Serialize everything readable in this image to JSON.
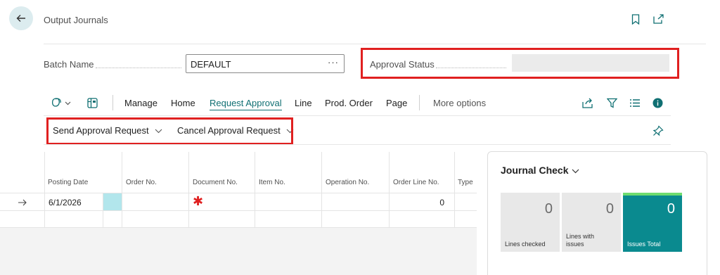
{
  "page": {
    "title": "Output Journals",
    "batch_label": "Batch Name",
    "batch_value": "DEFAULT",
    "batch_ellipsis": "···",
    "approval_status_label": "Approval Status",
    "approval_status_value": ""
  },
  "toolbar": {
    "items": [
      "Manage",
      "Home",
      "Request Approval",
      "Line",
      "Prod. Order",
      "Page"
    ],
    "active": "Request Approval",
    "more_options": "More options"
  },
  "subactions": {
    "send": "Send Approval Request",
    "cancel": "Cancel Approval Request"
  },
  "grid": {
    "columns": [
      "Posting Date",
      "Order No.",
      "Document No.",
      "Item No.",
      "Operation No.",
      "Order Line No.",
      "Type"
    ],
    "row1": {
      "posting_date": "6/1/2026",
      "order_no": "",
      "document_no_required": "✱",
      "item_no": "",
      "operation_no": "",
      "order_line_no": "0",
      "type": ""
    }
  },
  "journal_check": {
    "title": "Journal Check",
    "tiles": [
      {
        "value": "0",
        "label": "Lines checked"
      },
      {
        "value": "0",
        "label": "Lines with issues"
      },
      {
        "value": "0",
        "label": "Issues Total"
      }
    ]
  },
  "colors": {
    "accent": "#0f6f72",
    "highlight": "#e02020",
    "tile_teal": "#0a8a8f",
    "selected_cell": "#b2e6ec"
  }
}
